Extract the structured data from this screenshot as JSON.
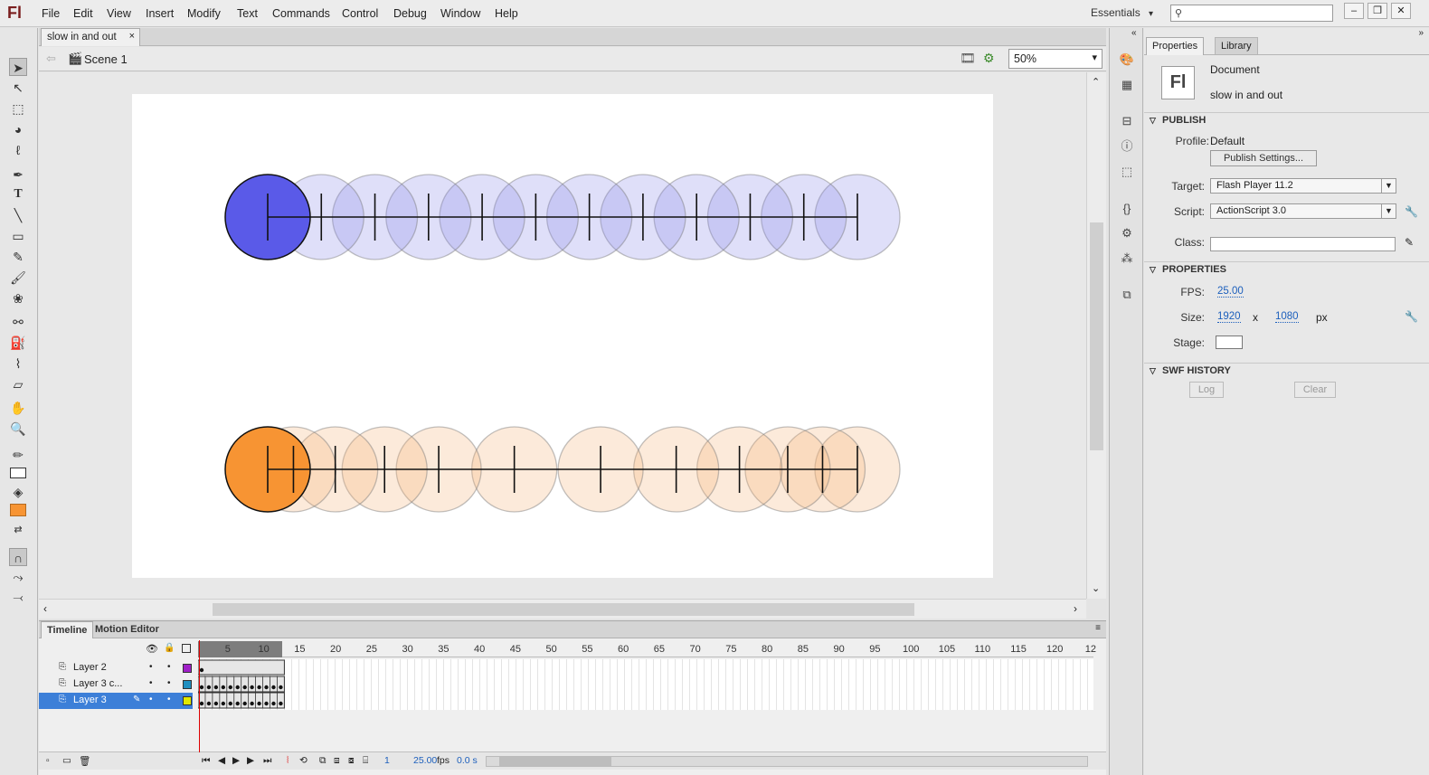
{
  "app": {
    "logo": "Fl"
  },
  "menu": [
    "File",
    "Edit",
    "View",
    "Insert",
    "Modify",
    "Text",
    "Commands",
    "Control",
    "Debug",
    "Window",
    "Help"
  ],
  "workspace": {
    "label": "Essentials",
    "arrow": "▾"
  },
  "search": {
    "placeholder": ""
  },
  "window_buttons": [
    "–",
    "❐",
    "✕"
  ],
  "document": {
    "tab_title": "slow in and out",
    "close_glyph": "×",
    "scene": "Scene 1",
    "zoom": "50%"
  },
  "stage": {
    "rows": [
      {
        "name": "linear-row",
        "fill_color": "#5a5ae8",
        "ghost_color": "#8c8ce8",
        "ticks_data": [
          0,
          1,
          2,
          3,
          4,
          5,
          6,
          7,
          8,
          9,
          10,
          11
        ]
      },
      {
        "name": "ease-row",
        "fill_color": "#f79433",
        "ghost_color": "#f3b37a",
        "ticks_data": [
          0,
          0.48,
          1.26,
          2.18,
          3.19,
          4.6,
          6.21,
          7.62,
          8.8,
          9.7,
          10.35,
          11
        ]
      }
    ]
  },
  "timeline": {
    "tabs": [
      "Timeline",
      "Motion Editor"
    ],
    "ruler": [
      "5",
      "10",
      "15",
      "20",
      "25",
      "30",
      "35",
      "40",
      "45",
      "50",
      "55",
      "60",
      "65",
      "70",
      "75",
      "80",
      "85",
      "90",
      "95",
      "100",
      "105",
      "110",
      "115",
      "120",
      "12"
    ],
    "layers": [
      {
        "name": "Layer 2",
        "color": "#a020c8",
        "selected": false
      },
      {
        "name": "Layer 3 c...",
        "color": "#1f8fc0",
        "selected": false
      },
      {
        "name": "Layer 3",
        "color": "#e0e800",
        "selected": true
      }
    ],
    "status": {
      "frame": "1",
      "fps": "25.00",
      "fps_unit": "fps",
      "time": "0.0 s"
    }
  },
  "properties": {
    "tabs": [
      "Properties",
      "Library"
    ],
    "doc_icon": "Fl",
    "doc_type": "Document",
    "doc_name": "slow in and out",
    "publish": {
      "header": "PUBLISH",
      "profile_label": "Profile:",
      "profile_value": "Default",
      "settings_button": "Publish Settings...",
      "target_label": "Target:",
      "target_value": "Flash Player 11.2",
      "script_label": "Script:",
      "script_value": "ActionScript 3.0",
      "class_label": "Class:"
    },
    "props": {
      "header": "PROPERTIES",
      "fps_label": "FPS:",
      "fps_value": "25.00",
      "size_label": "Size:",
      "width": "1920",
      "x": "x",
      "height": "1080",
      "unit": "px",
      "stage_label": "Stage:",
      "stage_color": "#ffffff"
    },
    "swf": {
      "header": "SWF HISTORY",
      "log_button": "Log",
      "clear_button": "Clear"
    }
  }
}
